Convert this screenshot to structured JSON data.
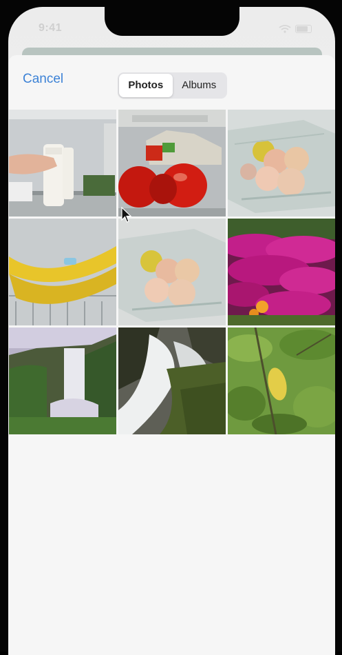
{
  "status_bar": {
    "time": "9:41"
  },
  "nav": {
    "cancel_label": "Cancel",
    "segments": [
      {
        "label": "Photos",
        "selected": true
      },
      {
        "label": "Albums",
        "selected": false
      }
    ]
  },
  "photos": [
    {
      "name": "photo-fridge-milk"
    },
    {
      "name": "photo-tomatoes"
    },
    {
      "name": "photo-apples-box"
    },
    {
      "name": "photo-bananas"
    },
    {
      "name": "photo-apples-box-2"
    },
    {
      "name": "photo-purple-flowers"
    },
    {
      "name": "photo-waterfall"
    },
    {
      "name": "photo-waterfall-closeup"
    },
    {
      "name": "photo-lemon-tree"
    }
  ],
  "colors": {
    "accent": "#3c82d6",
    "background": "#f6f6f6"
  }
}
